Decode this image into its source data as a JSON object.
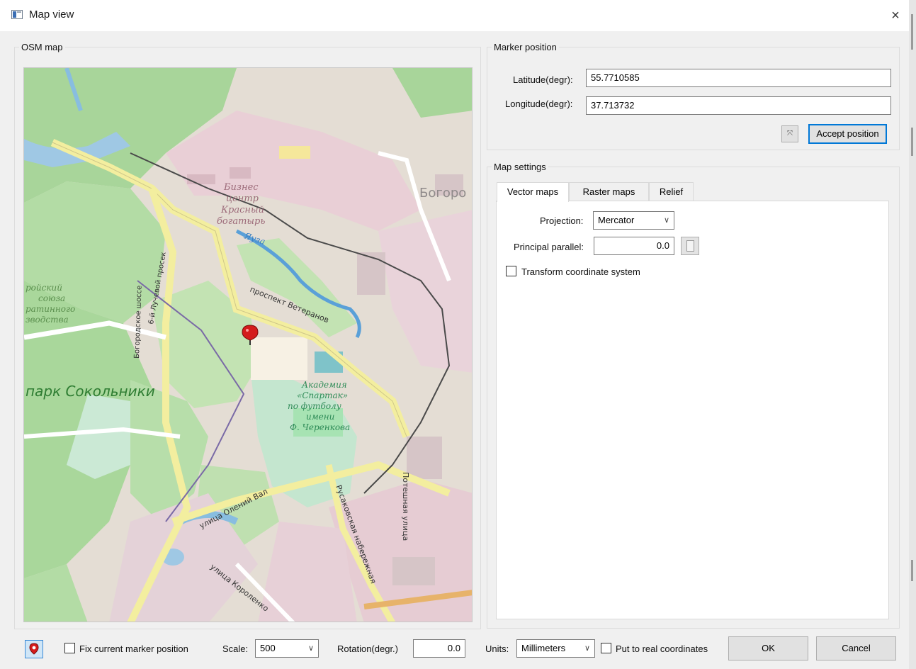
{
  "window": {
    "title": "Map view",
    "close_glyph": "×"
  },
  "osm_group": {
    "label": "OSM map"
  },
  "map": {
    "labels": [
      "Бизнес",
      "центр",
      "Красный",
      "богатырь",
      "Богоро",
      "проспект Ветеранов",
      "парк Сокольники",
      "Академия",
      "«Спартак»",
      "по футболу",
      "имени",
      "Ф. Черенкова",
      "улица Олений Вал",
      "улица Короленко",
      "Русаковская набережная",
      "Потешная улица",
      "Богородское шоссе",
      "6-й Лучевой просек",
      "Яуза",
      "ройский",
      "союза",
      "ратинного",
      "зводства"
    ]
  },
  "marker_group": {
    "label": "Marker position",
    "latitude_label": "Latitude(degr):",
    "latitude_value": "55.7710585",
    "longitude_label": "Longitude(degr):",
    "longitude_value": "37.713732",
    "collapse_icon": "collapse-icon",
    "accept_label": "Accept position"
  },
  "map_settings": {
    "label": "Map settings",
    "tabs": [
      "Vector maps",
      "Raster maps",
      "Relief"
    ],
    "projection_label": "Projection:",
    "projection_value": "Mercator",
    "parallel_label": "Principal parallel:",
    "parallel_value": "0.0",
    "transform_label": "Transform coordinate system"
  },
  "bottom": {
    "marker_icon": "map-pin-icon",
    "fix_label": "Fix current marker position",
    "scale_label": "Scale:",
    "scale_value": "500",
    "rotation_label": "Rotation(degr.)",
    "rotation_value": "0.0",
    "units_label": "Units:",
    "units_value": "Millimeters",
    "real_coords_label": "Put to real coordinates",
    "ok_label": "OK",
    "cancel_label": "Cancel"
  },
  "colors": {
    "accent": "#0078d7",
    "pin": "#d41c1c",
    "park": "#a9d79b",
    "road": "#f3ee9f"
  }
}
